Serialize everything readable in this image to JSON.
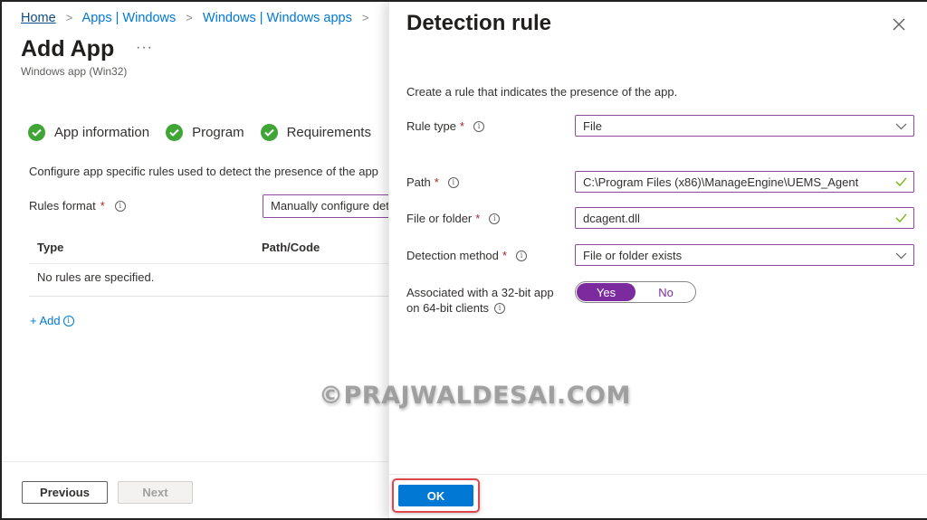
{
  "breadcrumb": {
    "items": [
      "Home",
      "Apps | Windows",
      "Windows | Windows apps"
    ],
    "separator": ">"
  },
  "page": {
    "title": "Add App",
    "more": "···",
    "subtitle": "Windows app (Win32)"
  },
  "steps": [
    {
      "label": "App information",
      "status": "complete"
    },
    {
      "label": "Program",
      "status": "complete"
    },
    {
      "label": "Requirements",
      "status": "complete"
    }
  ],
  "detection": {
    "description": "Configure app specific rules used to detect the presence of the app",
    "rules_format_label": "Rules format",
    "rules_format_value": "Manually configure detection rules",
    "table": {
      "columns": [
        "Type",
        "Path/Code"
      ],
      "empty_text": "No rules are specified."
    },
    "add_label": "+ Add"
  },
  "footer": {
    "previous_label": "Previous",
    "next_label": "Next"
  },
  "panel": {
    "title": "Detection rule",
    "description": "Create a rule that indicates the presence of the app.",
    "fields": {
      "rule_type": {
        "label": "Rule type",
        "value": "File"
      },
      "path": {
        "label": "Path",
        "value": "C:\\Program Files (x86)\\ManageEngine\\UEMS_Agent"
      },
      "file_or_folder": {
        "label": "File or folder",
        "value": "dcagent.dll"
      },
      "detection_method": {
        "label": "Detection method",
        "value": "File or folder exists"
      },
      "associated_32bit": {
        "label_line1": "Associated with a 32-bit app",
        "label_line2": "on 64-bit clients",
        "options": [
          "Yes",
          "No"
        ],
        "selected": "Yes"
      }
    },
    "ok_label": "OK"
  },
  "required_marker": "*",
  "info_glyph": "i",
  "watermark": "©PRAJWALDESAI.COM",
  "colors": {
    "accent": "#0078d4",
    "toggle_on": "#7b2b9e",
    "field_border": "#8c4a9c",
    "success": "#3fa535",
    "highlight": "#e0474c"
  }
}
